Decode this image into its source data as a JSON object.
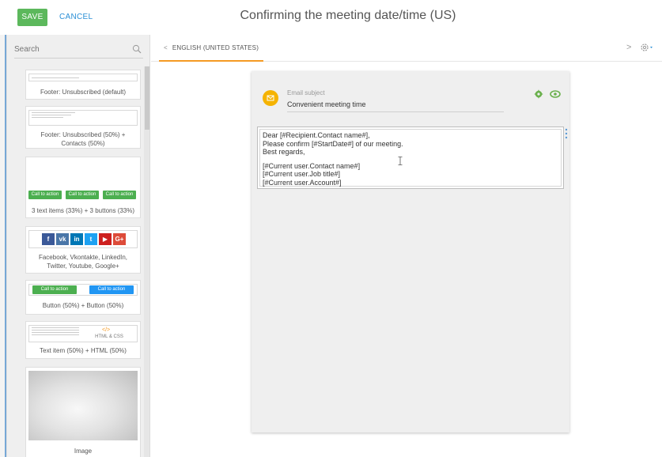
{
  "header": {
    "save_label": "SAVE",
    "cancel_label": "CANCEL",
    "title": "Confirming the meeting date/time (US)"
  },
  "sidebar": {
    "search_placeholder": "Search",
    "blocks": [
      {
        "caption": "Footer: Unsubscribed (default)"
      },
      {
        "caption_line1": "Footer: Unsubscribed (50%) +",
        "caption_line2": "Contacts (50%)"
      },
      {
        "caption": "3 text items (33%) + 3 buttons (33%)",
        "button_label": "Call to action"
      },
      {
        "caption_line1": "Facebook, Vkontakte, LinkedIn,",
        "caption_line2": "Twitter, Youtube, Google+"
      },
      {
        "caption": "Button (50%) + Button (50%)",
        "button_label": "Call to action"
      },
      {
        "caption": "Text item (50%) + HTML (50%)",
        "html_label": "HTML & CSS"
      },
      {
        "caption": "Image"
      }
    ]
  },
  "tabs": {
    "language": "ENGLISH (UNITED STATES)"
  },
  "email": {
    "subject_label": "Email subject",
    "subject_value": "Convenient meeting time",
    "body_lines": [
      "Dear [#Recipient.Contact name#],",
      "Please confirm [#StartDate#] of our meeting.",
      "Best regards,",
      "[#Current user.Contact name#]",
      "[#Current user.Job title#]",
      "[#Current user.Account#]"
    ]
  },
  "colors": {
    "save_green": "#5cb85c",
    "cancel_blue": "#2b8fd6",
    "tab_accent": "#f59a23",
    "subject_icon": "#f5b300",
    "action_green": "#6ab04c",
    "cta_green": "#4caf50",
    "cta_blue": "#2196f3"
  },
  "icons": {
    "search": "search-icon",
    "gear": "gear-icon",
    "eye": "eye-icon",
    "envelope": "envelope-icon",
    "chevron_left": "chevron-left-icon",
    "chevron_right": "chevron-right-icon"
  }
}
